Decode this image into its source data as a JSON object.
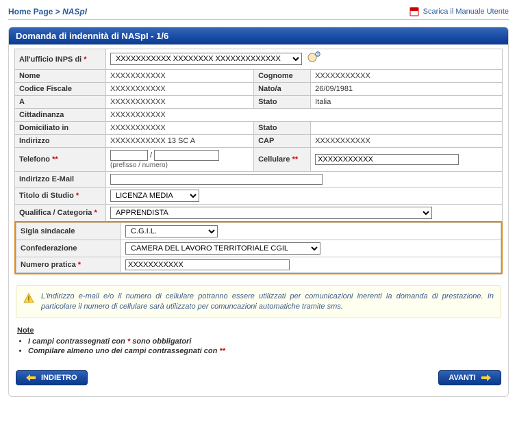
{
  "breadcrumb": {
    "home": "Home Page",
    "sep": ">",
    "current": "NASpI"
  },
  "manual_link": "Scarica il Manuale Utente",
  "panel_title": "Domanda di indennità di NASpI - 1/6",
  "labels": {
    "ufficio": "All'ufficio INPS di",
    "nome": "Nome",
    "cognome": "Cognome",
    "cf": "Codice Fiscale",
    "nato": "Nato/a",
    "a": "A",
    "stato": "Stato",
    "citt": "Cittadinanza",
    "dom": "Domiciliato in",
    "stato2": "Stato",
    "indirizzo": "Indirizzo",
    "cap": "CAP",
    "telefono": "Telefono",
    "cell": "Cellulare",
    "email": "Indirizzo E-Mail",
    "tds": "Titolo di Studio",
    "qual": "Qualifica / Categoria",
    "sigla": "Sigla sindacale",
    "conf": "Confederazione",
    "pratica": "Numero pratica"
  },
  "values": {
    "ufficio": "XXXXXXXXXXX XXXXXXXX XXXXXXXXXXXXX",
    "nome": "XXXXXXXXXXX",
    "cognome": "XXXXXXXXXXX",
    "cf": "XXXXXXXXXXX",
    "nato": "26/09/1981",
    "a": "XXXXXXXXXXX",
    "stato": "Italia",
    "citt": "XXXXXXXXXXX",
    "dom": "XXXXXXXXXXX",
    "stato2": "",
    "indirizzo": "XXXXXXXXXXX 13 SC A",
    "cap": "XXXXXXXXXXX",
    "tel_pref": "",
    "tel_num": "",
    "tel_note": "(prefisso / numero)",
    "cell": "XXXXXXXXXXX",
    "email": "",
    "tds": "LICENZA MEDIA",
    "qual": "APPRENDISTA",
    "sigla": "C.G.I.L.",
    "conf": "CAMERA DEL LAVORO TERRITORIALE CGIL",
    "pratica": "XXXXXXXXXXX"
  },
  "info": "L'indirizzo e-mail e/o il numero di cellulare potranno essere utilizzati per comunicazioni inerenti la domanda di prestazione. In particolare il numero di cellulare sarà utilizzato per comuncazioni automatiche tramite sms.",
  "notes": {
    "heading": "Note",
    "items": [
      "I campi contrassegnati con * sono obbligatori",
      "Compilare almeno uno dei campi contrassegnati con **"
    ]
  },
  "buttons": {
    "back": "INDIETRO",
    "next": "AVANTI"
  }
}
